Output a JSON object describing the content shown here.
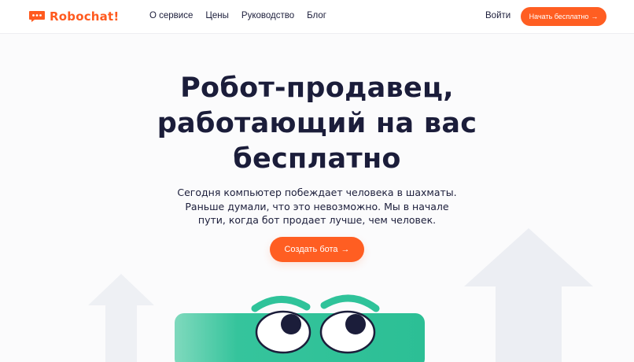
{
  "brand": {
    "name": "Robochat!",
    "color": "#ff5a1f",
    "logo_icon": "chat-bubble-icon"
  },
  "nav": {
    "items": [
      {
        "label": "О сервисе"
      },
      {
        "label": "Цены"
      },
      {
        "label": "Руководство"
      },
      {
        "label": "Блог"
      }
    ],
    "login_label": "Войти",
    "cta_label": "Начать бесплатно",
    "cta_icon": "arrow-right-icon"
  },
  "hero": {
    "title_lines": [
      "Робот-продавец,",
      "работающий на вас",
      "бесплатно"
    ],
    "subtitle_lines": [
      "Сегодня компьютер побеждает человека в шахматы.",
      "Раньше думали, что это невозможно. Мы в начале",
      "пути, когда бот продает лучше, чем человек."
    ],
    "cta_label": "Создать бота",
    "cta_icon": "arrow-right-icon"
  },
  "colors": {
    "accent": "#ff5e22",
    "text": "#1b1d3a",
    "robot": "#2fc39a",
    "decor_arrow": "#eceef3"
  }
}
